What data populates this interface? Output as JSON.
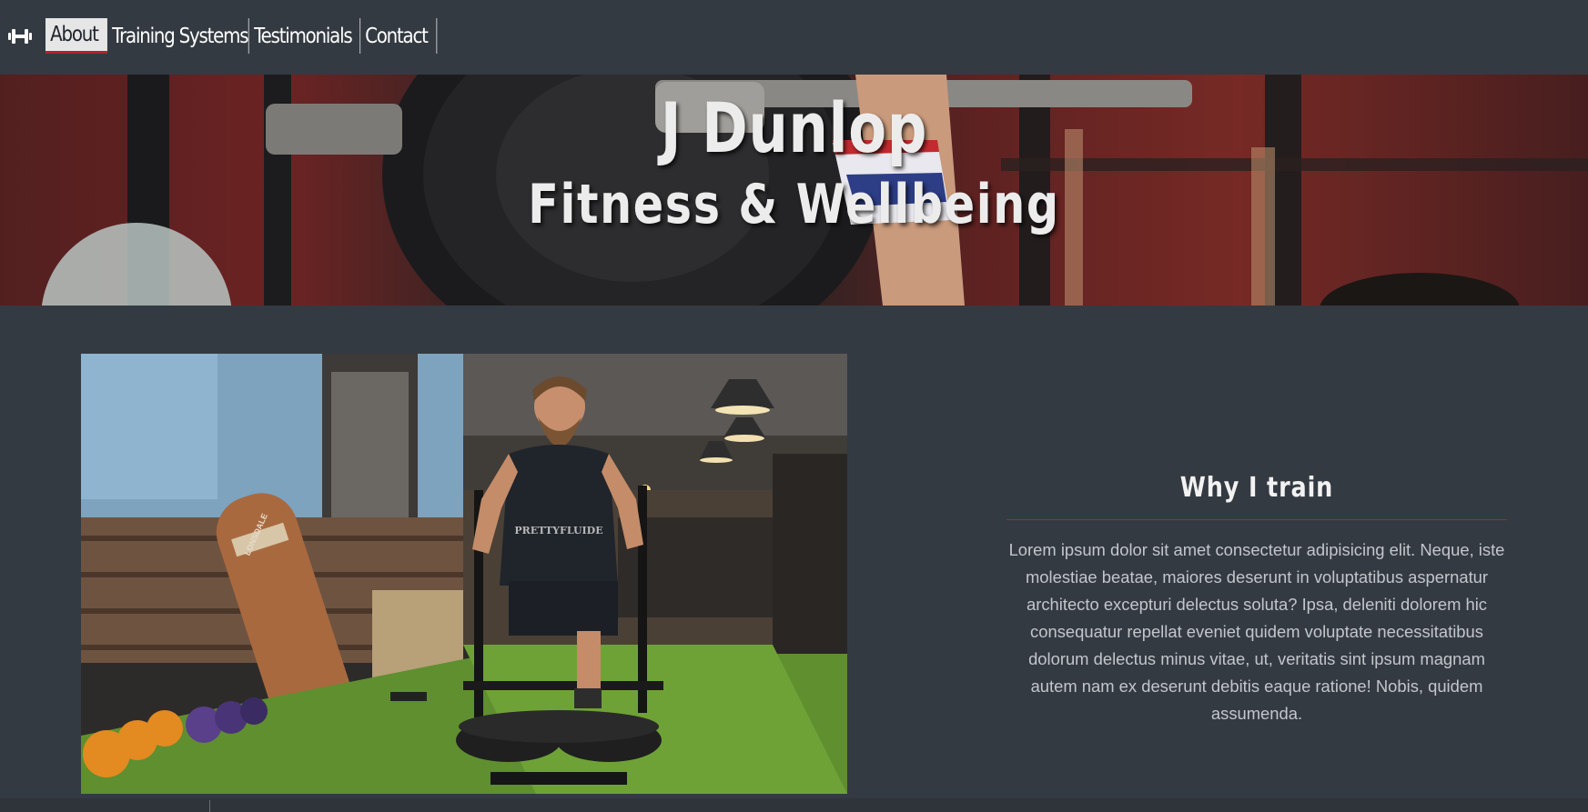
{
  "nav": {
    "logo_icon": "dumbbell-icon",
    "items": [
      {
        "label": "About",
        "active": true
      },
      {
        "label": "Training Systems",
        "active": false
      },
      {
        "label": "Testimonials",
        "active": false
      },
      {
        "label": "Contact",
        "active": false
      }
    ]
  },
  "hero": {
    "title": "J Dunlop",
    "subtitle": "Fitness & Wellbeing"
  },
  "about": {
    "heading": "Why I train",
    "body": "Lorem ipsum dolor sit amet consectetur adipisicing elit. Neque, iste molestiae beatae, maiores deserunt in voluptatibus aspernatur architecto excepturi delectus soluta? Ipsa, deleniti dolorem hic consequatur repellat eveniet quidem voluptate necessitatibus dolorum delectus minus vitae, ut, veritatis sint ipsum magnam autem nam ex deserunt debitis eaque ratione! Nobis, quidem assumenda.",
    "photo_shirt_text": "PRETTYFLUIDE",
    "photo_bag_text": "LONSDALE"
  },
  "colors": {
    "background": "#343a42",
    "accent": "#b0232b",
    "heading": "#f2f2f2",
    "body_text": "#c3c6cb"
  }
}
